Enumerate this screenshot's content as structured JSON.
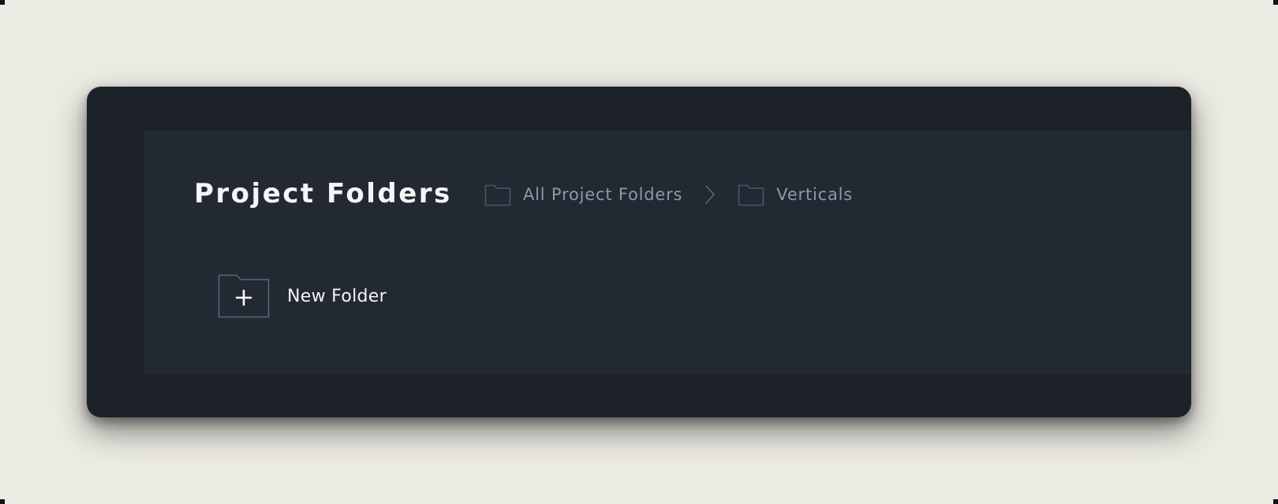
{
  "header": {
    "title": "Project Folders"
  },
  "breadcrumb": {
    "items": [
      {
        "label": "All Project Folders",
        "icon": "folder-icon"
      },
      {
        "label": "Verticals",
        "icon": "folder-icon"
      }
    ],
    "separator_icon": "chevron-right-icon"
  },
  "actions": {
    "new_folder_label": "New Folder",
    "new_folder_icon": "folder-plus-icon"
  },
  "colors": {
    "page_background": "#ecebe3",
    "window_background": "#1d2129",
    "panel_background": "#222932",
    "title_text": "#f4f5f7",
    "breadcrumb_text": "#8e98a6",
    "icon_stroke": "#4b5664"
  }
}
